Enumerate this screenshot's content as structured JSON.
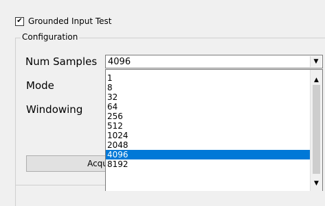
{
  "grounded_checkbox": {
    "label": "Grounded Input Test",
    "checked": true,
    "mark": "✔"
  },
  "configuration": {
    "title": "Configuration",
    "fields": {
      "num_samples": {
        "label": "Num Samples",
        "value": "4096"
      },
      "mode": {
        "label": "Mode"
      },
      "windowing": {
        "label": "Windowing"
      }
    }
  },
  "dropdown": {
    "options": [
      "1",
      "8",
      "32",
      "64",
      "256",
      "512",
      "1024",
      "2048",
      "4096",
      "8192"
    ],
    "selected": "4096"
  },
  "acquire_button": {
    "label": "Acqu"
  },
  "icons": {
    "combo_arrow": "▼",
    "scroll_up": "▲",
    "scroll_down": "▼"
  }
}
